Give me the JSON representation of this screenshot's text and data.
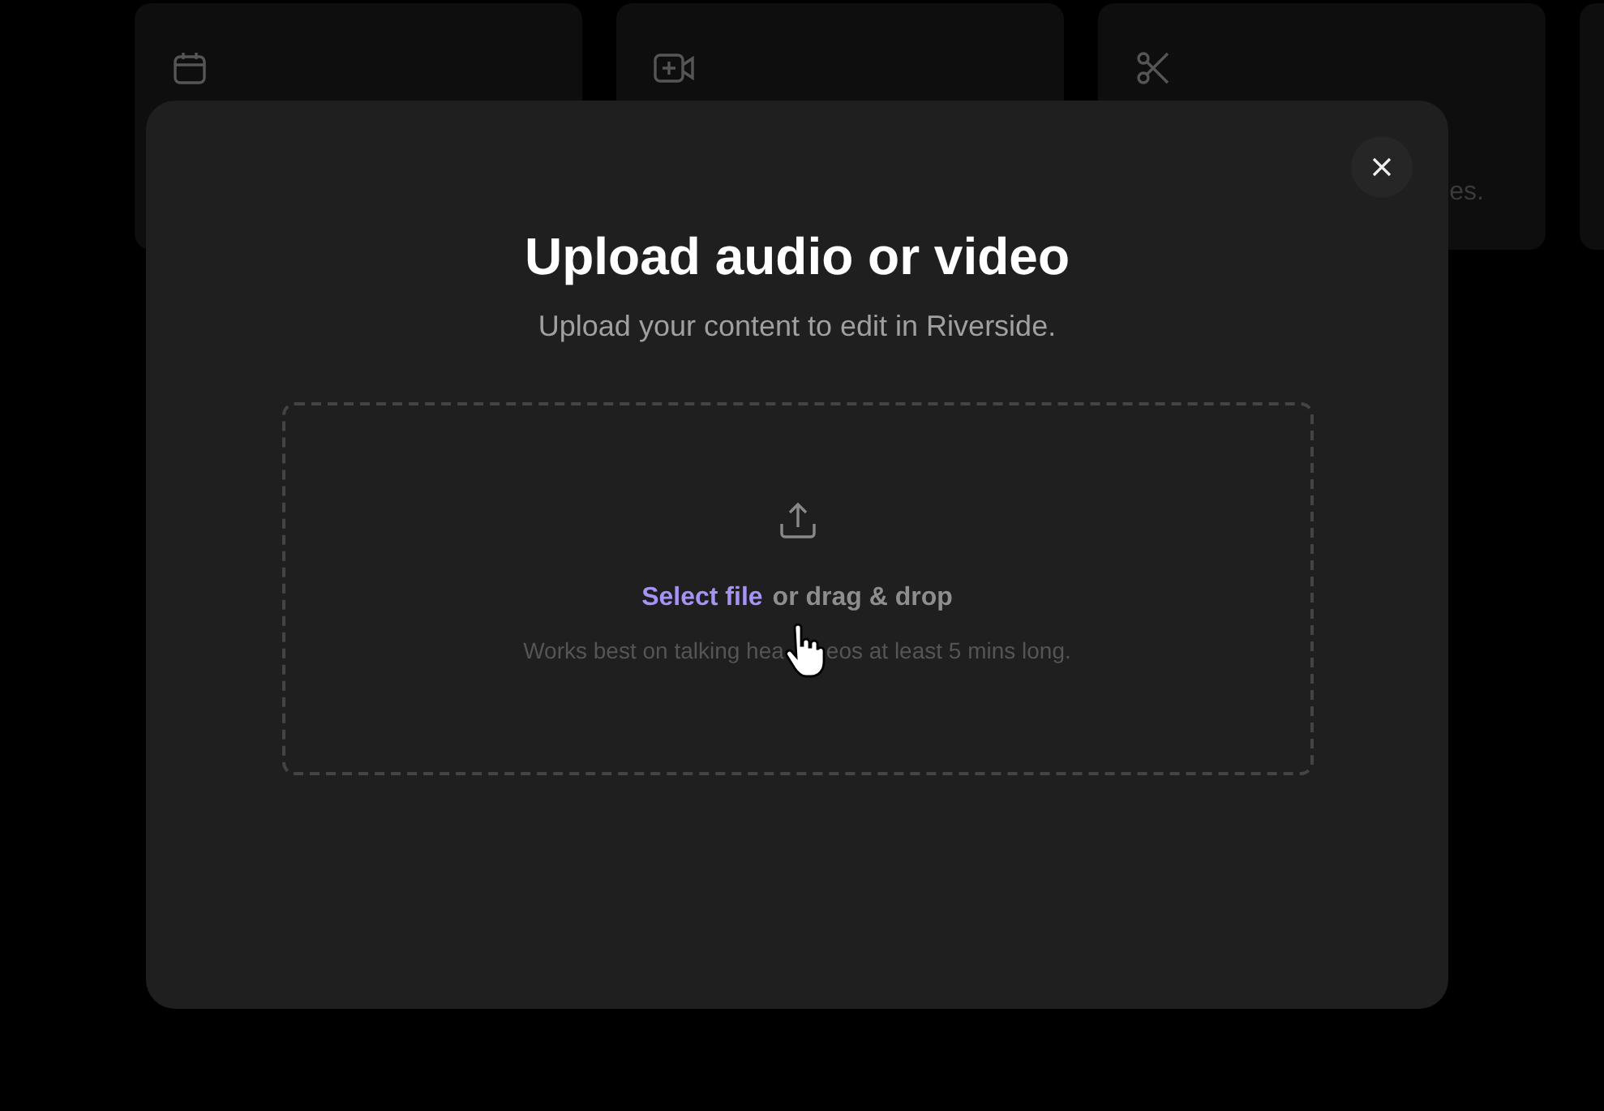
{
  "background_cards": [
    {
      "kind": "calendar"
    },
    {
      "kind": "video-add"
    },
    {
      "kind": "scissors",
      "text": "es."
    },
    {
      "kind": "blank"
    }
  ],
  "modal": {
    "title": "Upload audio or video",
    "subtitle": "Upload your content to edit in Riverside.",
    "dropzone": {
      "link": "Select file",
      "text": "or drag & drop",
      "hint_parts": [
        "Works best on talking hea",
        "eos at least 5 mins long."
      ]
    }
  }
}
